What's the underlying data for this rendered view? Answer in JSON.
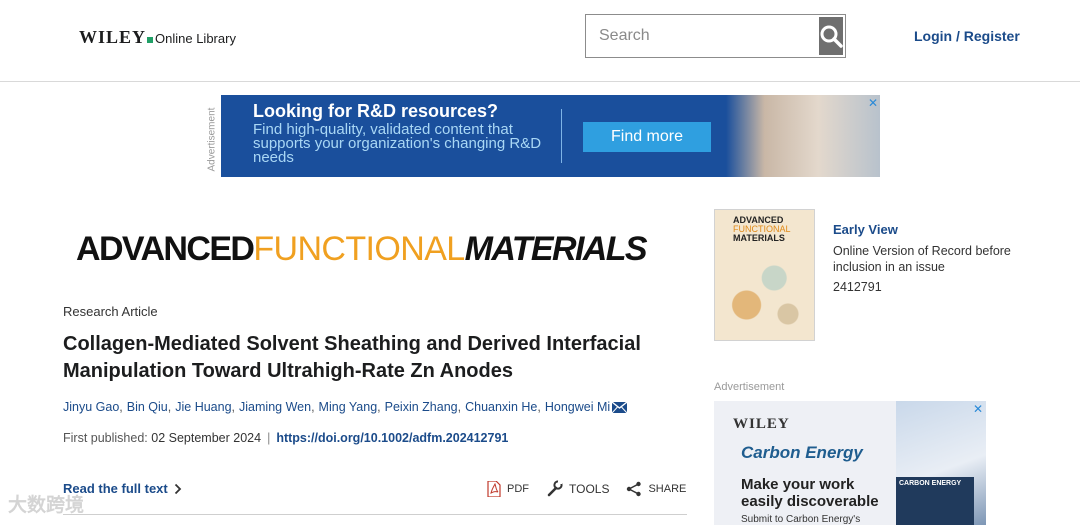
{
  "header": {
    "logo_brand": "WILEY",
    "logo_sub": "Online Library",
    "search_placeholder": "Search",
    "login_label": "Login / Register"
  },
  "top_ad": {
    "side_label": "Advertisement",
    "title": "Looking for R&D resources?",
    "description": "Find high-quality, validated content that supports your organization's changing R&D needs",
    "cta_label": "Find more",
    "close_label": "✕"
  },
  "journal": {
    "banner_part1": "ADVANCED",
    "banner_part2": "FUNCTIONAL",
    "banner_part3": "MATERIALS",
    "cover_title_line1": "ADVANCED",
    "cover_title_line2": "FUNCTIONAL",
    "cover_title_line3": "MATERIALS"
  },
  "article": {
    "type": "Research Article",
    "title": "Collagen-Mediated Solvent Sheathing and Derived Interfacial Manipulation Toward Ultrahigh-Rate Zn Anodes",
    "authors": [
      "Jinyu Gao",
      "Bin Qiu",
      "Jie Huang",
      "Jiaming Wen",
      "Ming Yang",
      "Peixin Zhang",
      "Chuanxin He",
      "Hongwei Mi"
    ],
    "first_published_label": "First published:",
    "first_published_date": "02 September 2024",
    "separator": "|",
    "doi": "https://doi.org/10.1002/adfm.202412791",
    "read_full_label": "Read the full text",
    "actions": {
      "pdf_label": "PDF",
      "tools_label": "TOOLS",
      "share_label": "SHARE"
    }
  },
  "sidebar": {
    "early_view_label": "Early View",
    "early_view_desc": "Online Version of Record before inclusion in an issue",
    "article_number": "2412791",
    "ad_label": "Advertisement",
    "ad_brand": "WILEY",
    "ad_journal": "Carbon Energy",
    "ad_headline": "Make your work easily discoverable",
    "ad_sub": "Submit to Carbon Energy's",
    "ad_cover_text": "CARBON ENERGY",
    "ad_close_label": "✕"
  },
  "colors": {
    "link": "#1b4b8a",
    "ad_blue": "#1a4f9c",
    "accent_orange": "#f0a020",
    "wiley_green": "#21a067"
  },
  "watermark": "大数跨境"
}
